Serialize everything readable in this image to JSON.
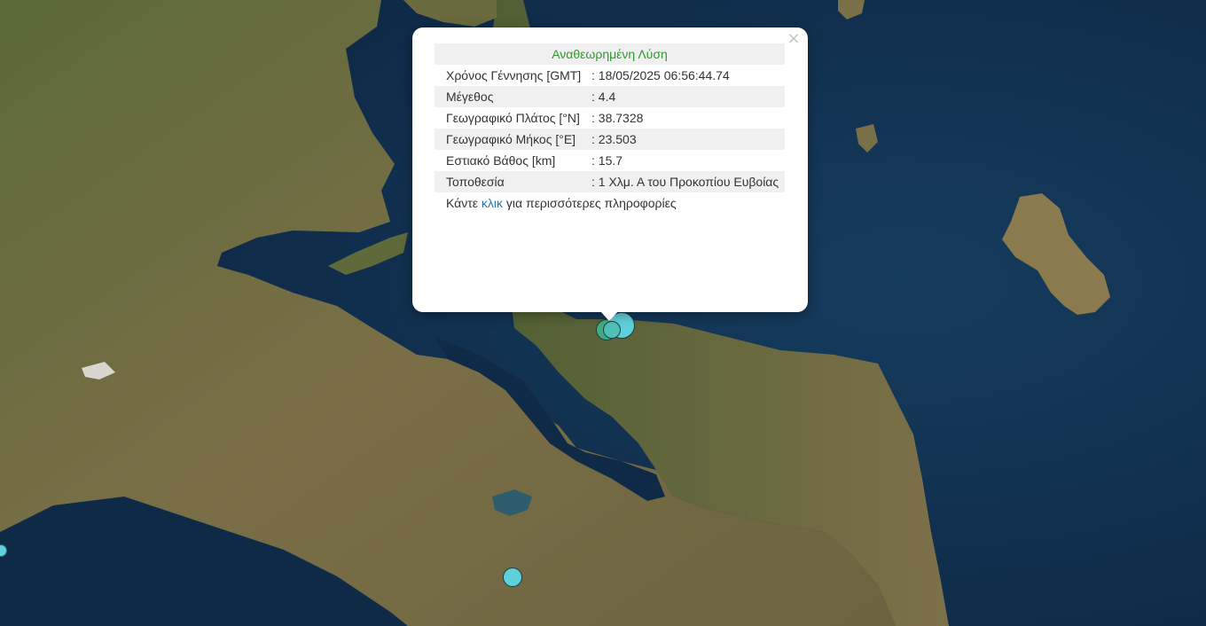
{
  "popup": {
    "title": "Αναθεωρημένη Λύση",
    "close_symbol": "×",
    "rows": [
      {
        "label": "Χρόνος Γέννησης [GMT]",
        "value": ": 18/05/2025 06:56:44.74"
      },
      {
        "label": "Μέγεθος",
        "value": ": 4.4"
      },
      {
        "label": "Γεωγραφικό Πλάτος [°N]",
        "value": ": 38.7328"
      },
      {
        "label": "Γεωγραφικό Μήκος [°E]",
        "value": ": 23.503"
      },
      {
        "label": "Εστιακό Βάθος [km]",
        "value": ": 15.7"
      },
      {
        "label": "Τοποθεσία",
        "value": ": 1 Χλμ. Α του Προκοπίου Ευβοίας"
      }
    ],
    "more_prefix": "Κάντε ",
    "more_link": "κλικ",
    "more_suffix": " για περισσότερες πληροφορίες"
  },
  "map": {
    "sea_color": "#10304d",
    "land_color": "#6e6a45",
    "marker_fill_recent": "#5fcfd9",
    "marker_fill_older": "#3fae7e"
  }
}
